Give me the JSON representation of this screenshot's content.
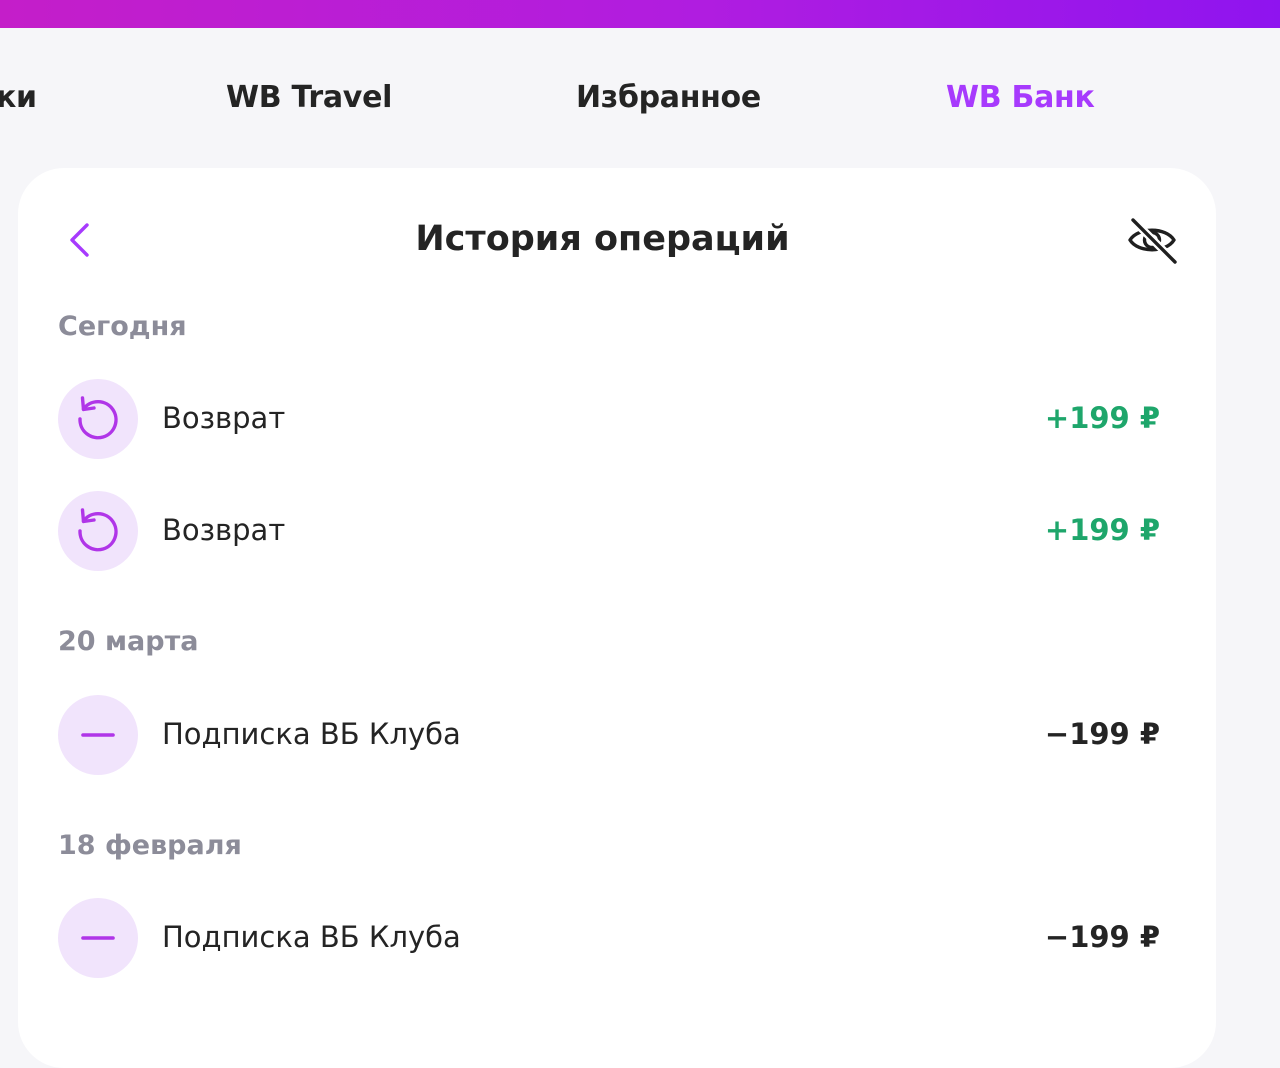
{
  "nav": {
    "tabs": [
      {
        "label": "ки"
      },
      {
        "label": "WB Travel"
      },
      {
        "label": "Избранное"
      },
      {
        "label": "WB Банк",
        "active": true
      }
    ]
  },
  "header": {
    "title": "История операций",
    "back_icon": "chevron-left-icon",
    "visibility_icon": "eye-off-icon"
  },
  "sections": [
    {
      "date": "Сегодня",
      "items": [
        {
          "icon": "refund-icon",
          "title": "Возврат",
          "amount": "+199 ₽",
          "type": "income"
        },
        {
          "icon": "refund-icon",
          "title": "Возврат",
          "amount": "+199 ₽",
          "type": "income"
        }
      ]
    },
    {
      "date": "20 марта",
      "items": [
        {
          "icon": "minus-icon",
          "title": "Подписка ВБ Клуба",
          "amount": "−199 ₽",
          "type": "expense"
        }
      ]
    },
    {
      "date": "18 февраля",
      "items": [
        {
          "icon": "minus-icon",
          "title": "Подписка ВБ Клуба",
          "amount": "−199 ₽",
          "type": "expense"
        }
      ]
    }
  ],
  "colors": {
    "accent": "#a73afd",
    "icon_stroke": "#b035e8",
    "icon_background": "#f1e4fc",
    "income": "#1ea66b",
    "expense": "#242424",
    "section_header": "#8c8c99"
  }
}
